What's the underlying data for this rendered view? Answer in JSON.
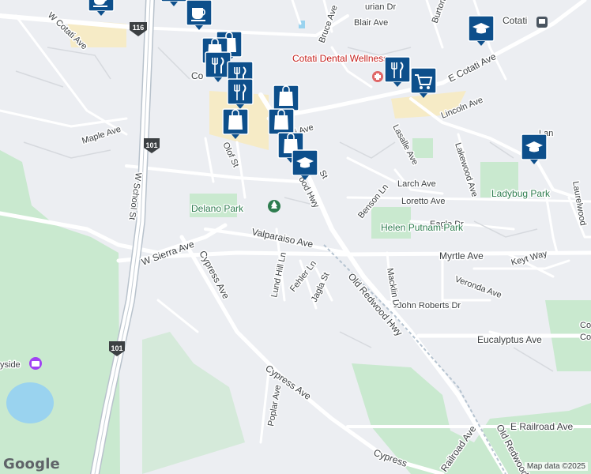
{
  "map": {
    "streets": [
      "W Cotati Ave",
      "Blair Ave",
      "Bruce Ave",
      "Burton",
      "E Cotati Ave",
      "Maple Ave",
      "Lincoln Ave",
      "Olof St",
      "Lasalle Ave",
      "Lakewood Ave",
      "Larch Ave",
      "Loretto Ave",
      "W School St",
      "Benson Ln",
      "Eagle Dr",
      "Valparaiso Ave",
      "W Sierra Ave",
      "Myrtle Ave",
      "Keyt Way",
      "Veronda Ave",
      "Cypress Ave",
      "Lund Hill Ln",
      "Fehler Ln",
      "Jagla St",
      "Old Redwood Hwy",
      "Macklin Dr",
      "John Roberts Dr",
      "Eucalyptus Ave",
      "Poplar Ave",
      "E Railroad Ave",
      "Railroad Ave",
      "Cypress",
      "Laurelwood",
      "Lan",
      "Old Redwood",
      "St",
      "ood Hwy",
      "ti Ave",
      "urian Dr"
    ],
    "highways": [
      "116",
      "101"
    ],
    "parks": [
      "Delano Park",
      "Ladybug Park",
      "Helen Putnam Park"
    ],
    "places": [
      "Cotati Dental Wellness",
      "Cotati",
      "Co",
      "yside",
      "Co",
      "Co"
    ],
    "markers": {
      "shopping": [
        "shopping-bag",
        "shopping-bag",
        "shopping-bag",
        "shopping-bag",
        "shopping-bag",
        "shopping-bag"
      ],
      "restaurant": [
        "fork-knife",
        "fork-knife",
        "fork-knife",
        "fork-knife"
      ],
      "cafe": [
        "coffee-cup",
        "coffee-cup",
        "coffee-cup"
      ],
      "school": [
        "graduation-cap",
        "graduation-cap",
        "graduation-cap"
      ],
      "grocery": [
        "shopping-cart"
      ]
    },
    "marker_color": "#0d4f8b",
    "park_color": "#c9e9cf"
  },
  "footer": {
    "logo": "Google",
    "attribution": "Map data ©2025"
  }
}
